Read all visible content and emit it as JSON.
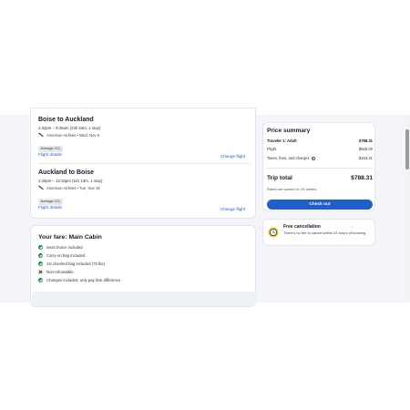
{
  "outbound": {
    "title": "Boise to Auckland",
    "time": "1:32pm – 9:25am (23h 53m, 1 stop)",
    "airline": "American Airlines • Wed, Nov 5",
    "co2": "Average CO₂",
    "details_link": "Flight details",
    "change_link": "Change flight"
  },
  "return": {
    "title": "Auckland to Boise",
    "time": "1:20pm – 12:33pm (11h 13m, 1 stop)",
    "airline": "American Airlines • Tue, Nov 18",
    "co2": "Average CO₂",
    "details_link": "Flight details",
    "change_link": "Change flight"
  },
  "fare": {
    "title": "Your fare: Main Cabin",
    "features": [
      {
        "icon": "check-icon",
        "label": "Seat choice included"
      },
      {
        "icon": "check-icon",
        "label": "Carry-on bag included"
      },
      {
        "icon": "check-icon",
        "label": "1st checked bag included (70 lbs)"
      },
      {
        "icon": "x-icon",
        "label": "Non-refundable"
      },
      {
        "icon": "check-icon",
        "label": "Changes included, only pay fare difference"
      }
    ]
  },
  "price_summary": {
    "title": "Price summary",
    "traveler_label": "Traveler 1: Adult",
    "traveler_value": "$788.31",
    "flight_label": "Flight",
    "flight_value": "$625.00",
    "taxes_label": "Taxes, fees, and charges",
    "taxes_value": "$163.31",
    "trip_total_label": "Trip total",
    "trip_total_value": "$788.31",
    "rates_note": "Rates are quoted in US dollars",
    "checkout_label": "Check out"
  },
  "free_cancellation": {
    "title": "Free cancellation",
    "text": "There's no fee to cancel within 24 hours of booking."
  },
  "colors": {
    "accent": "#1f5fcc",
    "check_green": "#1a8a4a",
    "cancel_icon_yellow": "#f5c518"
  }
}
